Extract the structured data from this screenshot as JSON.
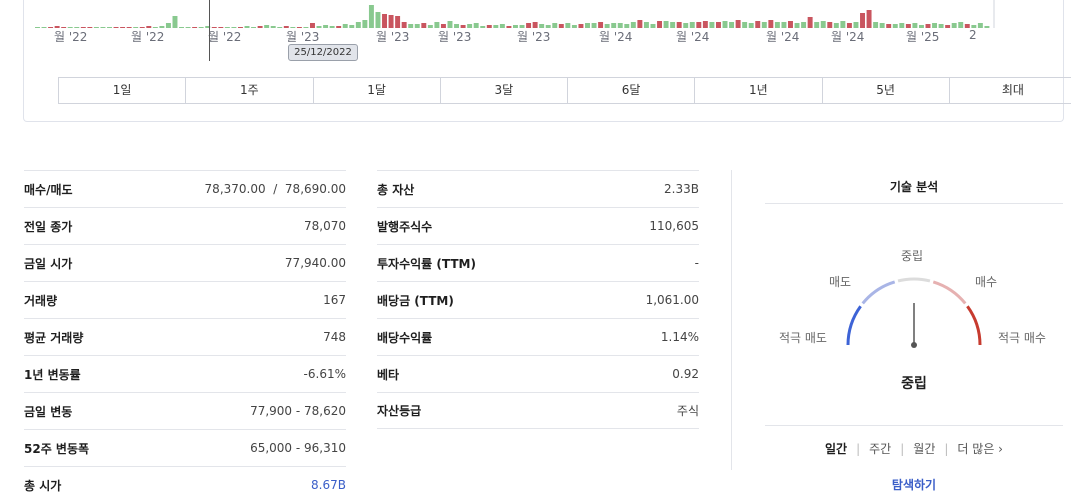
{
  "chart": {
    "x_labels": [
      "월 '22",
      "월 '22",
      "월 '22",
      "월 '23",
      "월 '23",
      "월 '23",
      "월 '23",
      "월 '24",
      "월 '24",
      "월 '24",
      "월 '24",
      "월 '25",
      "2"
    ],
    "crosshair_date": "25/12/2022",
    "ranges": [
      "1일",
      "1주",
      "1달",
      "3달",
      "6달",
      "1년",
      "5년",
      "최대"
    ],
    "colors": {
      "up": "#89c98f",
      "down": "#c9555f"
    },
    "volume_bars": [
      [
        1,
        "g"
      ],
      [
        1,
        "g"
      ],
      [
        1,
        "r"
      ],
      [
        2,
        "r"
      ],
      [
        1,
        "r"
      ],
      [
        1,
        "g"
      ],
      [
        1,
        "g"
      ],
      [
        1,
        "r"
      ],
      [
        1,
        "r"
      ],
      [
        1,
        "g"
      ],
      [
        1,
        "g"
      ],
      [
        1,
        "g"
      ],
      [
        1,
        "r"
      ],
      [
        1,
        "r"
      ],
      [
        1,
        "r"
      ],
      [
        1,
        "g"
      ],
      [
        1,
        "r"
      ],
      [
        2,
        "r"
      ],
      [
        1,
        "g"
      ],
      [
        2,
        "g"
      ],
      [
        5,
        "g"
      ],
      [
        12,
        "g"
      ],
      [
        1,
        "g"
      ],
      [
        1,
        "g"
      ],
      [
        1,
        "r"
      ],
      [
        1,
        "g"
      ],
      [
        2,
        "g"
      ],
      [
        1,
        "r"
      ],
      [
        1,
        "r"
      ],
      [
        1,
        "g"
      ],
      [
        1,
        "g"
      ],
      [
        1,
        "r"
      ],
      [
        2,
        "g"
      ],
      [
        1,
        "g"
      ],
      [
        2,
        "r"
      ],
      [
        3,
        "g"
      ],
      [
        2,
        "g"
      ],
      [
        1,
        "g"
      ],
      [
        2,
        "r"
      ],
      [
        1,
        "g"
      ],
      [
        1,
        "r"
      ],
      [
        1,
        "g"
      ],
      [
        5,
        "r"
      ],
      [
        2,
        "g"
      ],
      [
        3,
        "g"
      ],
      [
        2,
        "g"
      ],
      [
        2,
        "r"
      ],
      [
        4,
        "g"
      ],
      [
        3,
        "g"
      ],
      [
        6,
        "g"
      ],
      [
        8,
        "g"
      ],
      [
        23,
        "g"
      ],
      [
        16,
        "g"
      ],
      [
        14,
        "r"
      ],
      [
        13,
        "r"
      ],
      [
        12,
        "r"
      ],
      [
        6,
        "r"
      ],
      [
        4,
        "g"
      ],
      [
        4,
        "g"
      ],
      [
        5,
        "r"
      ],
      [
        3,
        "g"
      ],
      [
        6,
        "g"
      ],
      [
        4,
        "r"
      ],
      [
        7,
        "g"
      ],
      [
        4,
        "g"
      ],
      [
        3,
        "r"
      ],
      [
        4,
        "g"
      ],
      [
        5,
        "g"
      ],
      [
        2,
        "g"
      ],
      [
        3,
        "r"
      ],
      [
        3,
        "g"
      ],
      [
        4,
        "g"
      ],
      [
        2,
        "r"
      ],
      [
        3,
        "g"
      ],
      [
        3,
        "g"
      ],
      [
        5,
        "r"
      ],
      [
        6,
        "r"
      ],
      [
        4,
        "g"
      ],
      [
        3,
        "g"
      ],
      [
        5,
        "g"
      ],
      [
        4,
        "r"
      ],
      [
        5,
        "g"
      ],
      [
        3,
        "g"
      ],
      [
        4,
        "r"
      ],
      [
        5,
        "g"
      ],
      [
        5,
        "g"
      ],
      [
        6,
        "r"
      ],
      [
        4,
        "g"
      ],
      [
        5,
        "g"
      ],
      [
        5,
        "g"
      ],
      [
        4,
        "g"
      ],
      [
        6,
        "g"
      ],
      [
        8,
        "r"
      ],
      [
        6,
        "g"
      ],
      [
        4,
        "g"
      ],
      [
        7,
        "r"
      ],
      [
        7,
        "g"
      ],
      [
        6,
        "g"
      ],
      [
        6,
        "r"
      ],
      [
        5,
        "g"
      ],
      [
        6,
        "g"
      ],
      [
        6,
        "r"
      ],
      [
        7,
        "r"
      ],
      [
        6,
        "g"
      ],
      [
        6,
        "r"
      ],
      [
        7,
        "g"
      ],
      [
        6,
        "g"
      ],
      [
        8,
        "r"
      ],
      [
        6,
        "g"
      ],
      [
        5,
        "g"
      ],
      [
        7,
        "r"
      ],
      [
        6,
        "g"
      ],
      [
        8,
        "r"
      ],
      [
        6,
        "g"
      ],
      [
        6,
        "g"
      ],
      [
        7,
        "r"
      ],
      [
        5,
        "g"
      ],
      [
        6,
        "g"
      ],
      [
        11,
        "r"
      ],
      [
        6,
        "g"
      ],
      [
        7,
        "g"
      ],
      [
        6,
        "r"
      ],
      [
        5,
        "g"
      ],
      [
        7,
        "g"
      ],
      [
        5,
        "r"
      ],
      [
        6,
        "g"
      ],
      [
        15,
        "r"
      ],
      [
        18,
        "r"
      ],
      [
        6,
        "g"
      ],
      [
        5,
        "g"
      ],
      [
        4,
        "r"
      ],
      [
        4,
        "g"
      ],
      [
        5,
        "g"
      ],
      [
        4,
        "r"
      ],
      [
        5,
        "g"
      ],
      [
        3,
        "g"
      ],
      [
        4,
        "r"
      ],
      [
        5,
        "g"
      ],
      [
        4,
        "g"
      ],
      [
        3,
        "r"
      ],
      [
        5,
        "g"
      ],
      [
        6,
        "g"
      ],
      [
        4,
        "r"
      ],
      [
        3,
        "g"
      ],
      [
        5,
        "g"
      ],
      [
        2,
        "g"
      ]
    ]
  },
  "stats_left": [
    {
      "label": "매수/매도",
      "value": "78,370.00  /  78,690.00"
    },
    {
      "label": "전일 종가",
      "value": "78,070"
    },
    {
      "label": "금일 시가",
      "value": "77,940.00"
    },
    {
      "label": "거래량",
      "value": "167"
    },
    {
      "label": "평균 거래량",
      "value": "748"
    },
    {
      "label": "1년 변동률",
      "value": "-6.61%"
    },
    {
      "label": "금일 변동",
      "value": "77,900 - 78,620"
    },
    {
      "label": "52주 변동폭",
      "value": "65,000 - 96,310"
    },
    {
      "label": "총 시가",
      "value": "8.67B"
    }
  ],
  "stats_right": [
    {
      "label": "총 자산",
      "value": "2.33B"
    },
    {
      "label": "발행주식수",
      "value": "110,605"
    },
    {
      "label": "투자수익률 (TTM)",
      "value": "-"
    },
    {
      "label": "배당금 (TTM)",
      "value": "1,061.00"
    },
    {
      "label": "배당수익률",
      "value": "1.14%"
    },
    {
      "label": "베타",
      "value": "0.92"
    },
    {
      "label": "자산등급",
      "value": "주식"
    }
  ],
  "technical": {
    "title": "기술 분석",
    "labels": {
      "strong_sell": "적극 매도",
      "sell": "매도",
      "neutral": "중립",
      "buy": "매수",
      "strong_buy": "적극 매수"
    },
    "result": "중립",
    "needle_level": 0.5,
    "periods": [
      "일간",
      "주간",
      "월간",
      "더 많은 ›"
    ],
    "active_period": 0,
    "explore": "탐색하기",
    "colors": {
      "strong_sell": "#3d63d6",
      "sell": "#a9b5e6",
      "neutral": "#dcdcdc",
      "buy": "#e6b1b1",
      "strong_buy": "#c73b2f"
    }
  }
}
